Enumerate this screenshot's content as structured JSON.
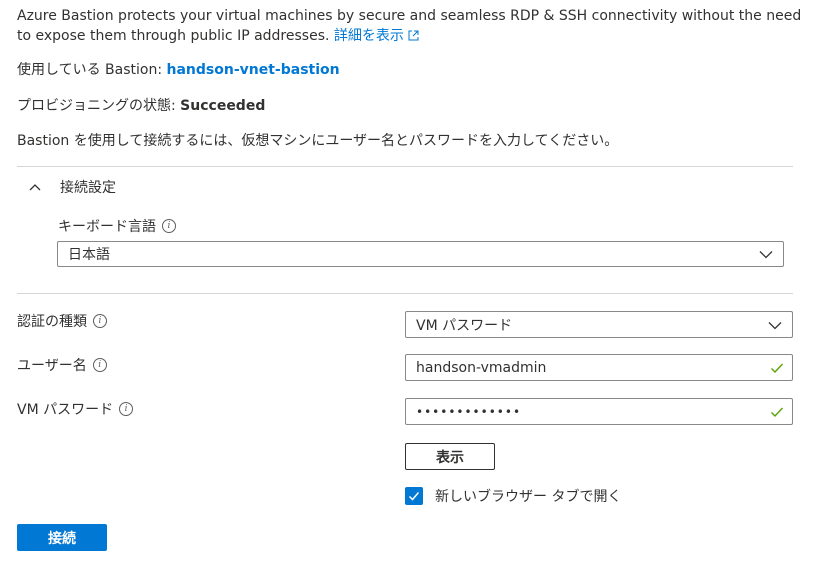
{
  "intro": {
    "text": "Azure Bastion protects your virtual machines by secure and seamless RDP & SSH connectivity without the need to expose them through public IP addresses.",
    "learn_more": "詳細を表示"
  },
  "bastion": {
    "label": "使用している Bastion:",
    "name": "handson-vnet-bastion"
  },
  "provisioning": {
    "label": "プロビジョニングの状態:",
    "value": "Succeeded"
  },
  "instruction": "Bastion を使用して接続するには、仮想マシンにユーザー名とパスワードを入力してください。",
  "connection_settings": {
    "title": "接続設定",
    "keyboard_label": "キーボード言語",
    "keyboard_value": "日本語"
  },
  "auth": {
    "type_label": "認証の種類",
    "type_value": "VM パスワード",
    "username_label": "ユーザー名",
    "username_value": "handson-vmadmin",
    "password_label": "VM パスワード",
    "password_value": "•••••••••••••"
  },
  "show_button": "表示",
  "new_tab_checkbox": {
    "label": "新しいブラウザー タブで開く",
    "checked": true
  },
  "connect_button": "接続",
  "colors": {
    "accent": "#0078d4",
    "valid": "#57a300"
  }
}
